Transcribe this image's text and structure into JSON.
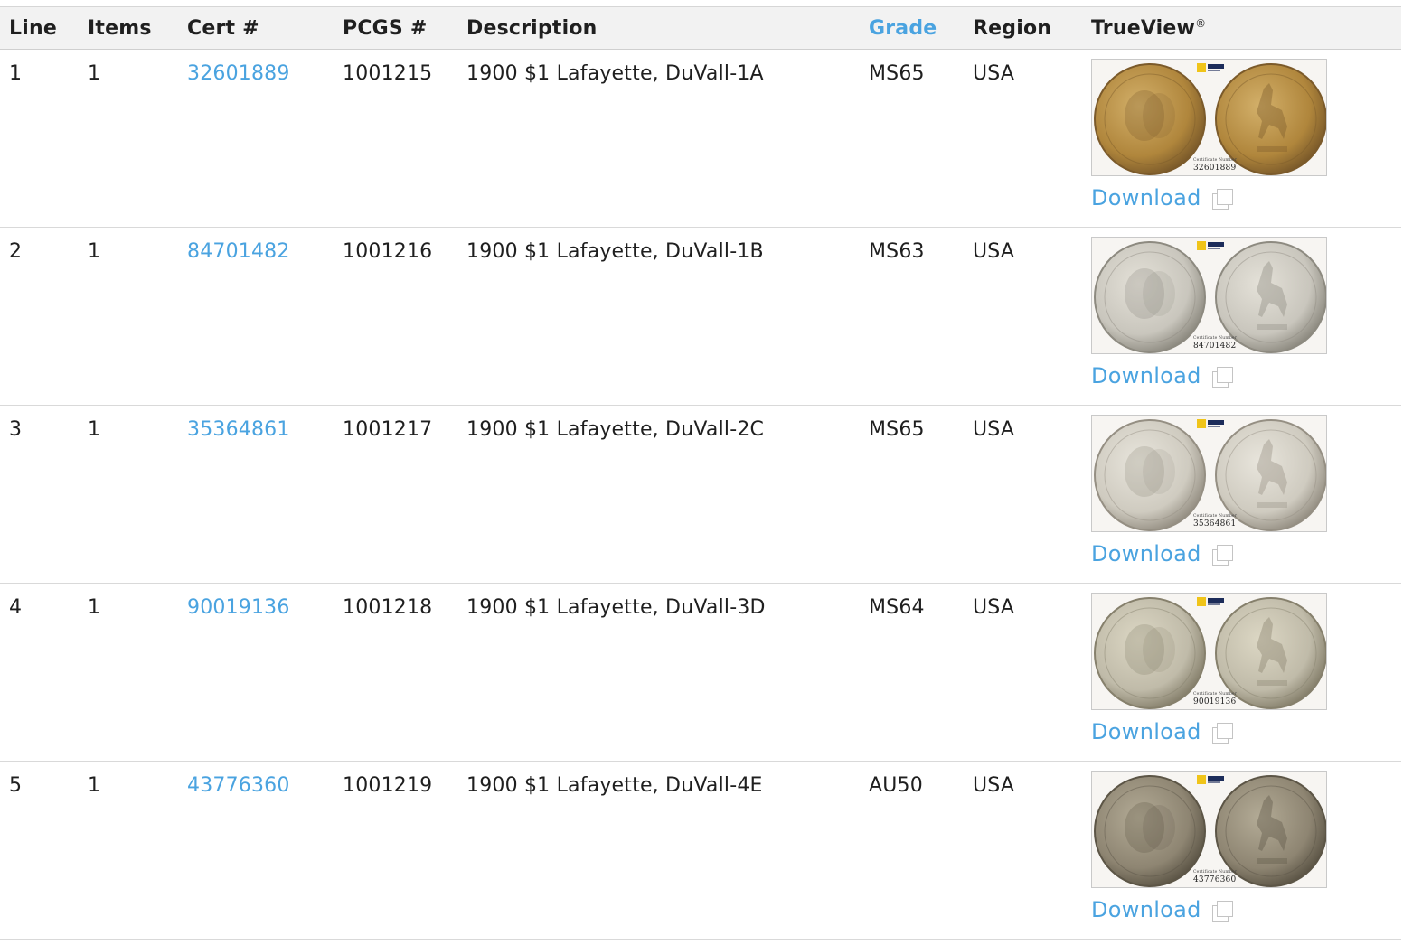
{
  "table": {
    "headers": {
      "line": "Line",
      "items": "Items",
      "cert": "Cert #",
      "pcgs": "PCGS #",
      "description": "Description",
      "grade": "Grade",
      "region": "Region",
      "trueview": "TrueView",
      "trueview_mark": "®"
    },
    "download_label": "Download",
    "rows": [
      {
        "line": "1",
        "items": "1",
        "cert": "32601889",
        "pcgs": "1001215",
        "description": "1900 $1 Lafayette, DuVall-1A",
        "grade": "MS65",
        "region": "USA",
        "tone": "#b0863c",
        "tone2": "#d3b06a",
        "tone_edge": "#7b5a2a"
      },
      {
        "line": "2",
        "items": "1",
        "cert": "84701482",
        "pcgs": "1001216",
        "description": "1900 $1 Lafayette, DuVall-1B",
        "grade": "MS63",
        "region": "USA",
        "tone": "#c9c6bd",
        "tone2": "#e4e1d8",
        "tone_edge": "#8d8a80"
      },
      {
        "line": "3",
        "items": "1",
        "cert": "35364861",
        "pcgs": "1001217",
        "description": "1900 $1 Lafayette, DuVall-2C",
        "grade": "MS65",
        "region": "USA",
        "tone": "#cfcbc0",
        "tone2": "#e8e5dc",
        "tone_edge": "#958f83"
      },
      {
        "line": "4",
        "items": "1",
        "cert": "90019136",
        "pcgs": "1001218",
        "description": "1900 $1 Lafayette, DuVall-3D",
        "grade": "MS64",
        "region": "USA",
        "tone": "#c0bba9",
        "tone2": "#dcd7c4",
        "tone_edge": "#86806c"
      },
      {
        "line": "5",
        "items": "1",
        "cert": "43776360",
        "pcgs": "1001219",
        "description": "1900 $1 Lafayette, DuVall-4E",
        "grade": "AU50",
        "region": "USA",
        "tone": "#8e8572",
        "tone2": "#b3ab96",
        "tone_edge": "#5c5546"
      }
    ]
  },
  "thumb_label": "Certificate Number",
  "colors": {
    "link": "#4aa3e0",
    "header_bg": "#f2f2f2",
    "logo_yellow": "#f0c419"
  }
}
